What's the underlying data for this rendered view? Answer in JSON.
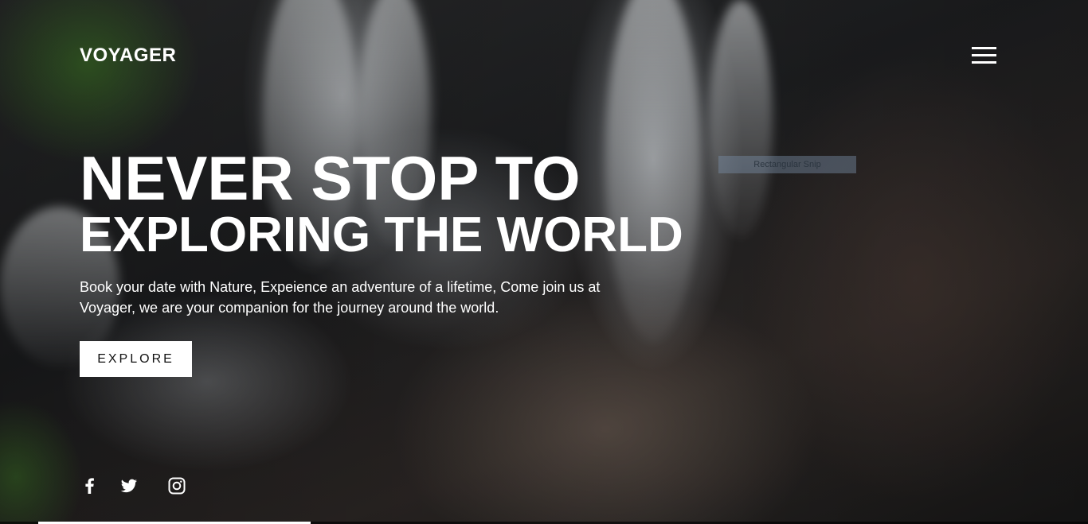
{
  "header": {
    "logo": "VOYAGER",
    "menu_icon": "hamburger-menu-icon"
  },
  "hero": {
    "headline_line1": "NEVER STOP TO",
    "headline_line2": "EXPLORING THE WORLD",
    "description": "Book your date with Nature, Expeience an adventure of a lifetime, Come join us at Voyager, we are your companion for the journey around the world.",
    "cta_label": "EXPLORE"
  },
  "overlay": {
    "snip_label": "Rectangular Snip"
  },
  "social": {
    "icons": [
      "facebook-icon",
      "twitter-icon",
      "instagram-icon"
    ]
  },
  "video_progress": 0.25,
  "colors": {
    "text": "#ffffff",
    "button_bg": "#ffffff",
    "button_text": "#111111"
  }
}
